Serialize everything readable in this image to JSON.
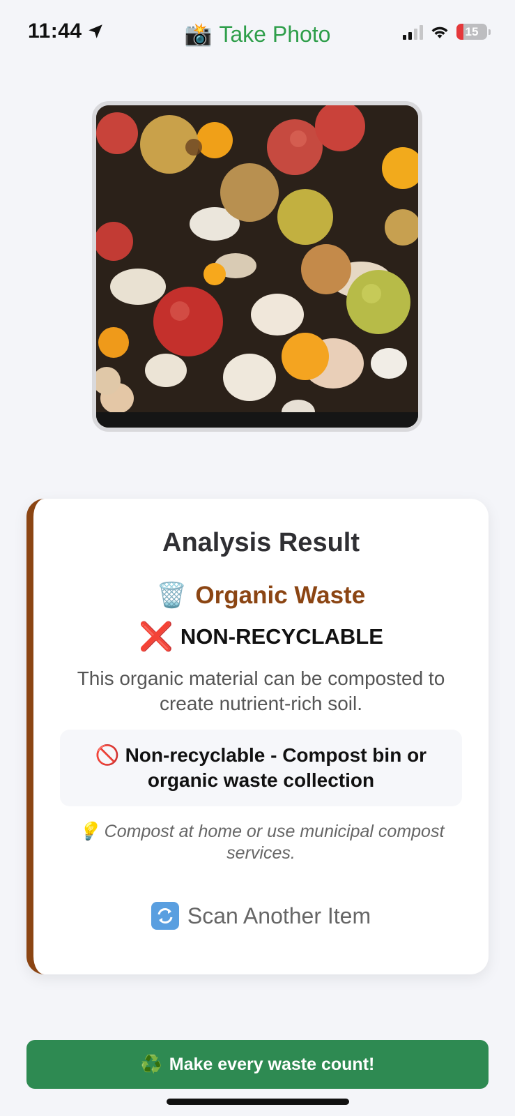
{
  "status_bar": {
    "time": "11:44",
    "battery": "15"
  },
  "nav": {
    "title": "Take Photo",
    "title_icon": "📸"
  },
  "photo": {
    "description_icon": "photo-of-organic-food-scraps"
  },
  "result": {
    "title": "Analysis Result",
    "category_icon": "🗑️",
    "category": "Organic Waste",
    "status_icon": "❌",
    "status": "NON-RECYCLABLE",
    "description": "This organic material can be composted to create nutrient-rich soil.",
    "disposal_icon": "🚫",
    "disposal": "Non-recyclable - Compost bin or organic waste collection",
    "tip_icon": "💡",
    "tip": "Compost at home or use municipal compost services.",
    "scan_again": "Scan Another Item"
  },
  "footer": {
    "icon": "♻️",
    "text": "Make every waste count!"
  },
  "colors": {
    "accent_green": "#2e9e4a",
    "banner_green": "#2e8a52",
    "organic_brown": "#8b4513",
    "red": "#e0202b"
  }
}
